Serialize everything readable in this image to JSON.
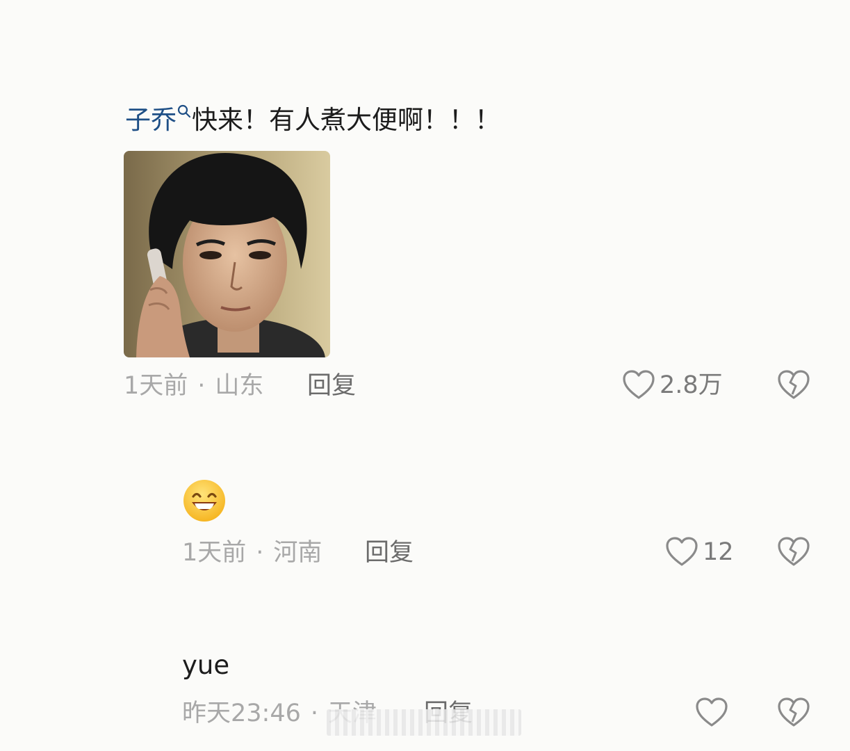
{
  "comments": [
    {
      "mention": "子乔",
      "text": "快来！有人煮大便啊！！！",
      "time": "1天前",
      "location": "山东",
      "reply_label": "回复",
      "likes": "2.8万"
    },
    {
      "emoji": "grinning-face",
      "time": "1天前",
      "location": "河南",
      "reply_label": "回复",
      "likes": "12"
    },
    {
      "text": "yue",
      "time": "昨天23:46",
      "location": "天津",
      "reply_label": "回复",
      "likes": ""
    }
  ],
  "meta_separator": "·",
  "colors": {
    "mention": "#1e4f86",
    "meta": "#a8a8a8",
    "icon": "#8a8a8a"
  }
}
